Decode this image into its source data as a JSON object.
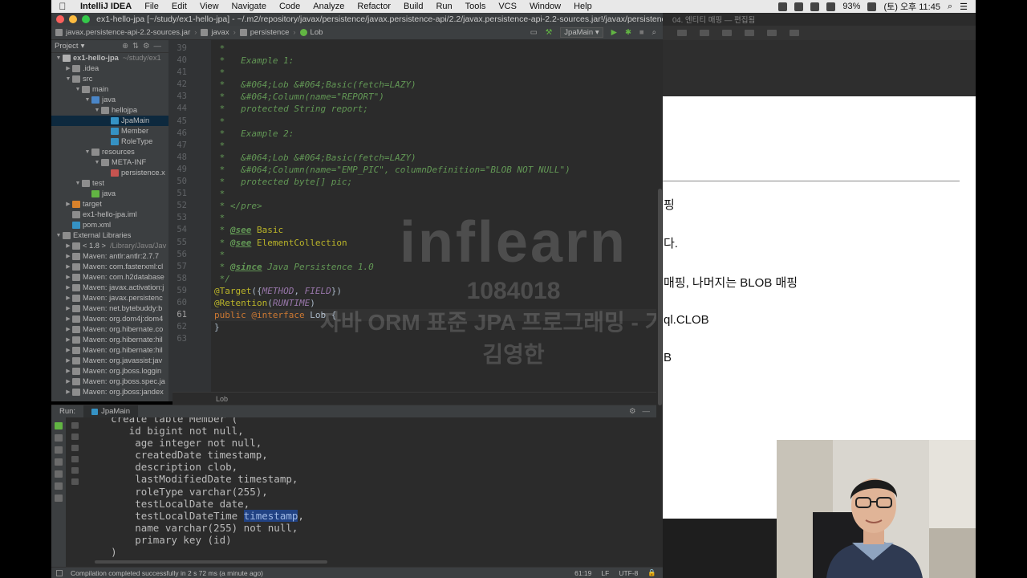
{
  "menubar": {
    "app": "IntelliJ IDEA",
    "items": [
      "File",
      "Edit",
      "View",
      "Navigate",
      "Code",
      "Analyze",
      "Refactor",
      "Build",
      "Run",
      "Tools",
      "VCS",
      "Window",
      "Help"
    ],
    "battery": "93%",
    "clock": "(토) 오후 11:45"
  },
  "titlebar": {
    "title": "ex1-hello-jpa [~/study/ex1-hello-jpa] - ~/.m2/repository/javax/persistence/javax.persistence-api/2.2/javax.persistence-api-2.2-sources.jar!/javax/persistence/Lob.jav...",
    "right_window_title": "04. 엔티티 매핑 — 편집됨"
  },
  "navbar": {
    "crumbs": [
      "javax.persistence-api-2.2-sources.jar",
      "javax",
      "persistence",
      "Lob"
    ],
    "run_config": "JpaMain"
  },
  "project": {
    "header": "Project",
    "tree": [
      {
        "label": "ex1-hello-jpa",
        "extra": "~/study/ex1",
        "depth": 0,
        "arrow": "▼",
        "color": "#b0b0b0",
        "bold": true
      },
      {
        "label": ".idea",
        "depth": 1,
        "arrow": "▶",
        "color": "#8d8d8d"
      },
      {
        "label": "src",
        "depth": 1,
        "arrow": "▼",
        "color": "#8d8d8d"
      },
      {
        "label": "main",
        "depth": 2,
        "arrow": "▼",
        "color": "#8d8d8d"
      },
      {
        "label": "java",
        "depth": 3,
        "arrow": "▼",
        "color": "#4a86c8"
      },
      {
        "label": "hellojpa",
        "depth": 4,
        "arrow": "▼",
        "color": "#8d8d8d"
      },
      {
        "label": "JpaMain",
        "depth": 5,
        "arrow": "",
        "color": "#3592c4",
        "selected": true
      },
      {
        "label": "Member",
        "depth": 5,
        "arrow": "",
        "color": "#3592c4"
      },
      {
        "label": "RoleType",
        "depth": 5,
        "arrow": "",
        "color": "#3592c4"
      },
      {
        "label": "resources",
        "depth": 3,
        "arrow": "▼",
        "color": "#8d8d8d"
      },
      {
        "label": "META-INF",
        "depth": 4,
        "arrow": "▼",
        "color": "#8d8d8d"
      },
      {
        "label": "persistence.x",
        "depth": 5,
        "arrow": "",
        "color": "#c75450"
      },
      {
        "label": "test",
        "depth": 2,
        "arrow": "▼",
        "color": "#8d8d8d"
      },
      {
        "label": "java",
        "depth": 3,
        "arrow": "",
        "color": "#62b543"
      },
      {
        "label": "target",
        "depth": 1,
        "arrow": "▶",
        "color": "#d9822b"
      },
      {
        "label": "ex1-hello-jpa.iml",
        "depth": 1,
        "arrow": "",
        "color": "#8d8d8d"
      },
      {
        "label": "pom.xml",
        "depth": 1,
        "arrow": "",
        "color": "#3592c4"
      },
      {
        "label": "External Libraries",
        "depth": 0,
        "arrow": "▼",
        "color": "#8d8d8d"
      },
      {
        "label": "< 1.8 >",
        "extra": "/Library/Java/Jav",
        "depth": 1,
        "arrow": "▶",
        "color": "#8d8d8d"
      },
      {
        "label": "Maven: antlr:antlr:2.7.7",
        "depth": 1,
        "arrow": "▶",
        "color": "#8d8d8d"
      },
      {
        "label": "Maven: com.fasterxml:cl",
        "depth": 1,
        "arrow": "▶",
        "color": "#8d8d8d"
      },
      {
        "label": "Maven: com.h2database",
        "depth": 1,
        "arrow": "▶",
        "color": "#8d8d8d"
      },
      {
        "label": "Maven: javax.activation:j",
        "depth": 1,
        "arrow": "▶",
        "color": "#8d8d8d"
      },
      {
        "label": "Maven: javax.persistenc",
        "depth": 1,
        "arrow": "▶",
        "color": "#8d8d8d"
      },
      {
        "label": "Maven: net.bytebuddy:b",
        "depth": 1,
        "arrow": "▶",
        "color": "#8d8d8d"
      },
      {
        "label": "Maven: org.dom4j:dom4",
        "depth": 1,
        "arrow": "▶",
        "color": "#8d8d8d"
      },
      {
        "label": "Maven: org.hibernate.co",
        "depth": 1,
        "arrow": "▶",
        "color": "#8d8d8d"
      },
      {
        "label": "Maven: org.hibernate:hil",
        "depth": 1,
        "arrow": "▶",
        "color": "#8d8d8d"
      },
      {
        "label": "Maven: org.hibernate:hil",
        "depth": 1,
        "arrow": "▶",
        "color": "#8d8d8d"
      },
      {
        "label": "Maven: org.javassist:jav",
        "depth": 1,
        "arrow": "▶",
        "color": "#8d8d8d"
      },
      {
        "label": "Maven: org.jboss.loggin",
        "depth": 1,
        "arrow": "▶",
        "color": "#8d8d8d"
      },
      {
        "label": "Maven: org.jboss.spec.ja",
        "depth": 1,
        "arrow": "▶",
        "color": "#8d8d8d"
      },
      {
        "label": "Maven: org.jboss:jandex",
        "depth": 1,
        "arrow": "▶",
        "color": "#8d8d8d"
      }
    ]
  },
  "editor": {
    "line_numbers": [
      "39",
      "40",
      "41",
      "42",
      "43",
      "44",
      "45",
      "46",
      "47",
      "48",
      "49",
      "50",
      "51",
      "52",
      "53",
      "54",
      "55",
      "56",
      "57",
      "58",
      "59",
      "60",
      "61",
      "62",
      "63"
    ],
    "current_line": "61",
    "breadcrumb": "Lob",
    "lines": [
      [
        {
          "t": " *",
          "c": "cm"
        }
      ],
      [
        {
          "t": " *   Example 1:",
          "c": "cm"
        }
      ],
      [
        {
          "t": " *",
          "c": "cm"
        }
      ],
      [
        {
          "t": " *   &#064;Lob &#064;Basic(fetch=LAZY)",
          "c": "cm"
        }
      ],
      [
        {
          "t": " *   &#064;Column(name=\"REPORT\")",
          "c": "cm"
        }
      ],
      [
        {
          "t": " *   protected String report;",
          "c": "cm"
        }
      ],
      [
        {
          "t": " *",
          "c": "cm"
        }
      ],
      [
        {
          "t": " *   Example 2:",
          "c": "cm"
        }
      ],
      [
        {
          "t": " *",
          "c": "cm"
        }
      ],
      [
        {
          "t": " *   &#064;Lob &#064;Basic(fetch=LAZY)",
          "c": "cm"
        }
      ],
      [
        {
          "t": " *   &#064;Column(name=\"EMP_PIC\", columnDefinition=\"BLOB NOT NULL\")",
          "c": "cm"
        }
      ],
      [
        {
          "t": " *   protected byte[] pic;",
          "c": "cm"
        }
      ],
      [
        {
          "t": " *",
          "c": "cm"
        }
      ],
      [
        {
          "t": " * </pre>",
          "c": "cm"
        }
      ],
      [
        {
          "t": " *",
          "c": "cm"
        }
      ],
      [
        {
          "t": " * ",
          "c": "cm"
        },
        {
          "t": "@see",
          "c": "tg"
        },
        {
          "t": " Basic",
          "c": "ty"
        }
      ],
      [
        {
          "t": " * ",
          "c": "cm"
        },
        {
          "t": "@see",
          "c": "tg"
        },
        {
          "t": " ElementCollection",
          "c": "ty"
        }
      ],
      [
        {
          "t": " *",
          "c": "cm"
        }
      ],
      [
        {
          "t": " * ",
          "c": "cm"
        },
        {
          "t": "@since",
          "c": "tg"
        },
        {
          "t": " Java Persistence 1.0",
          "c": "cm"
        }
      ],
      [
        {
          "t": " */",
          "c": "cm"
        }
      ],
      [
        {
          "t": "@Target",
          "c": "an"
        },
        {
          "t": "({",
          "c": "plain"
        },
        {
          "t": "METHOD",
          "c": "it"
        },
        {
          "t": ", ",
          "c": "plain"
        },
        {
          "t": "FIELD",
          "c": "it"
        },
        {
          "t": "})",
          "c": "plain"
        }
      ],
      [
        {
          "t": "@Retention",
          "c": "an"
        },
        {
          "t": "(",
          "c": "plain"
        },
        {
          "t": "RUNTIME",
          "c": "it"
        },
        {
          "t": ")",
          "c": "plain"
        }
      ],
      [
        {
          "t": "public ",
          "c": "kw"
        },
        {
          "t": "@interface ",
          "c": "kw"
        },
        {
          "t": "Lob {",
          "c": "plain"
        }
      ],
      [
        {
          "t": "}",
          "c": "plain"
        }
      ],
      [
        {
          "t": "",
          "c": "plain"
        }
      ]
    ]
  },
  "watermark": {
    "logo": "inflearn",
    "number": "1084018",
    "line1": "자바 ORM 표준 JPA 프로그래밍 - 기본편",
    "line2": "김영한"
  },
  "run": {
    "label": "Run:",
    "tab": "JpaMain",
    "console": [
      "    create table Member (",
      "       id bigint not null,",
      "        age integer not null,",
      "        createdDate timestamp,",
      "        description clob,",
      "        lastModifiedDate timestamp,",
      "        roleType varchar(255),",
      "        testLocalDate date,",
      "        testLocalDateTime ",
      "        name varchar(255) not null,",
      "        primary key (id)",
      "    )"
    ],
    "highlight": "timestamp",
    "highlight_suffix": ","
  },
  "statusbar": {
    "message": "Compilation completed successfully in 2 s 72 ms (a minute ago)",
    "position": "61:19",
    "line_sep": "LF",
    "encoding": "UTF-8"
  },
  "slide": {
    "lines": [
      "핑",
      "다.",
      "매핑, 나머지는 BLOB 매핑",
      "ql.CLOB",
      "B"
    ]
  },
  "colors": {
    "accent_selection": "#0d293e",
    "close": "#fc605c",
    "minimize": "#fdbc40",
    "zoom": "#34c84a"
  }
}
